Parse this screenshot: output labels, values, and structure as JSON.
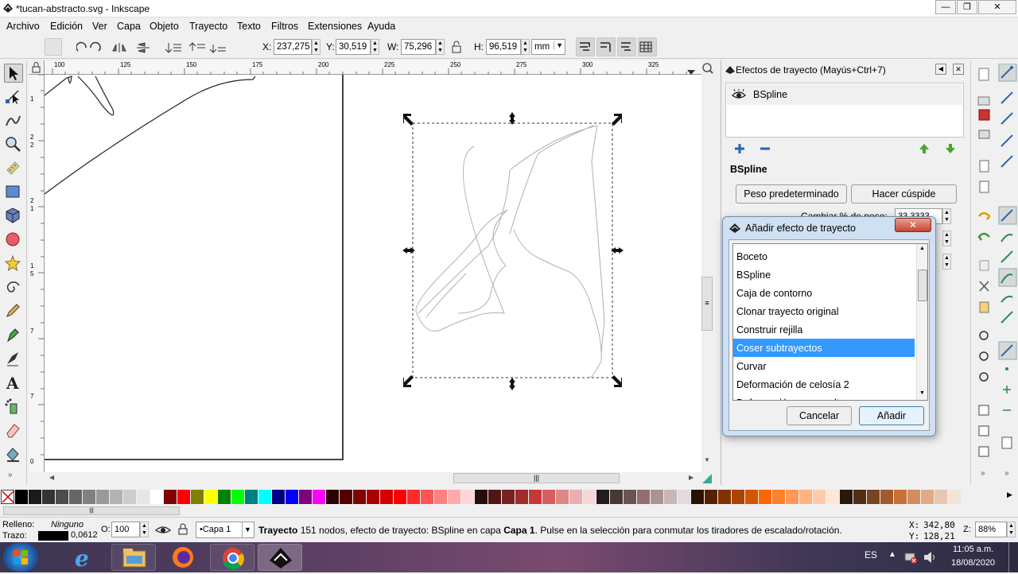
{
  "window": {
    "title": "*tucan-abstracto.svg - Inkscape",
    "min": "—",
    "max": "❐",
    "close": "✕"
  },
  "menu": [
    "Archivo",
    "Edición",
    "Ver",
    "Capa",
    "Objeto",
    "Trayecto",
    "Texto",
    "Filtros",
    "Extensiones",
    "Ayuda"
  ],
  "controls": {
    "x_label": "X:",
    "x": "237,275",
    "y_label": "Y:",
    "y": "30,519",
    "w_label": "W:",
    "w": "75,296",
    "h_label": "H:",
    "h": "96,519",
    "unit": "mm"
  },
  "ruler": {
    "h_ticks": [
      "100",
      "125",
      "150",
      "175",
      "200",
      "225",
      "250",
      "275",
      "300",
      "325"
    ],
    "v_ticks": [
      "1",
      "2",
      "2",
      "2",
      "1",
      "1",
      "5",
      "7",
      "7",
      "0"
    ]
  },
  "lpe_panel": {
    "title": "Efectos de trayecto (Mayús+Ctrl+7)",
    "effects": [
      {
        "name": "BSpline",
        "visible": true
      }
    ],
    "current": "BSpline",
    "btn_default": "Peso predeterminado",
    "btn_cusp": "Hacer cúspide",
    "param_label": "Cambiar % de peso:",
    "param_value": "33,3333"
  },
  "dialog": {
    "title": "Añadir efecto de trayecto",
    "items": [
      "Boceto",
      "BSpline",
      "Caja de contorno",
      "Clonar trayecto original",
      "Construir rejilla",
      "Coser subtrayectos",
      "Curvar",
      "Deformación de celosía 2",
      "Deformación por envoltura"
    ],
    "selected_index": 5,
    "cancel": "Cancelar",
    "add": "Añadir"
  },
  "palette_colors": [
    "#000000",
    "#1a1a1a",
    "#333333",
    "#4d4d4d",
    "#666666",
    "#808080",
    "#999999",
    "#b3b3b3",
    "#cccccc",
    "#e6e6e6",
    "#ffffff",
    "#800000",
    "#ff0000",
    "#808000",
    "#ffff00",
    "#008000",
    "#00ff00",
    "#008080",
    "#00ffff",
    "#000080",
    "#0000ff",
    "#800080",
    "#ff00ff",
    "#2b0000",
    "#550000",
    "#800000",
    "#aa0000",
    "#d40000",
    "#ff0000",
    "#ff2a2a",
    "#ff5555",
    "#ff8080",
    "#ffaaaa",
    "#ffd5d5",
    "#280b0b",
    "#501616",
    "#782121",
    "#a02c2c",
    "#c83737",
    "#d35f5f",
    "#de8787",
    "#e9afaf",
    "#f4d7d7",
    "#241c1c",
    "#483737",
    "#6c5353",
    "#916f6f",
    "#ac9393",
    "#c8b7b7",
    "#e3dbdb",
    "#2b1100",
    "#552200",
    "#803300",
    "#aa4400",
    "#d45500",
    "#ff6600",
    "#ff7f2a",
    "#ff9955",
    "#ffb380",
    "#ffccaa",
    "#ffe6d5",
    "#28170b",
    "#502d16",
    "#784421",
    "#a05a2c",
    "#c87137",
    "#d38d5f",
    "#deaa87",
    "#e9c6af",
    "#f4e3d7"
  ],
  "status": {
    "fill_label": "Relleno:",
    "fill_value": "Ninguno",
    "stroke_label": "Trazo:",
    "stroke_width": "0,0612",
    "opacity_label": "O:",
    "opacity": "100",
    "layer": "•Capa 1",
    "msg_bold1": "Trayecto",
    "msg_text1": " 151 nodos, efecto de trayecto: BSpline en capa ",
    "msg_bold2": "Capa 1",
    "msg_text2": ". Pulse en la selección para conmutar los tiradores de escalado/rotación.",
    "cx_label": "X:",
    "cx": "342,80",
    "cy_label": "Y:",
    "cy": "128,21",
    "zoom_label": "Z:",
    "zoom": "88%"
  },
  "taskbar": {
    "lang": "ES",
    "time": "11:05 a.m.",
    "date": "18/08/2020"
  }
}
